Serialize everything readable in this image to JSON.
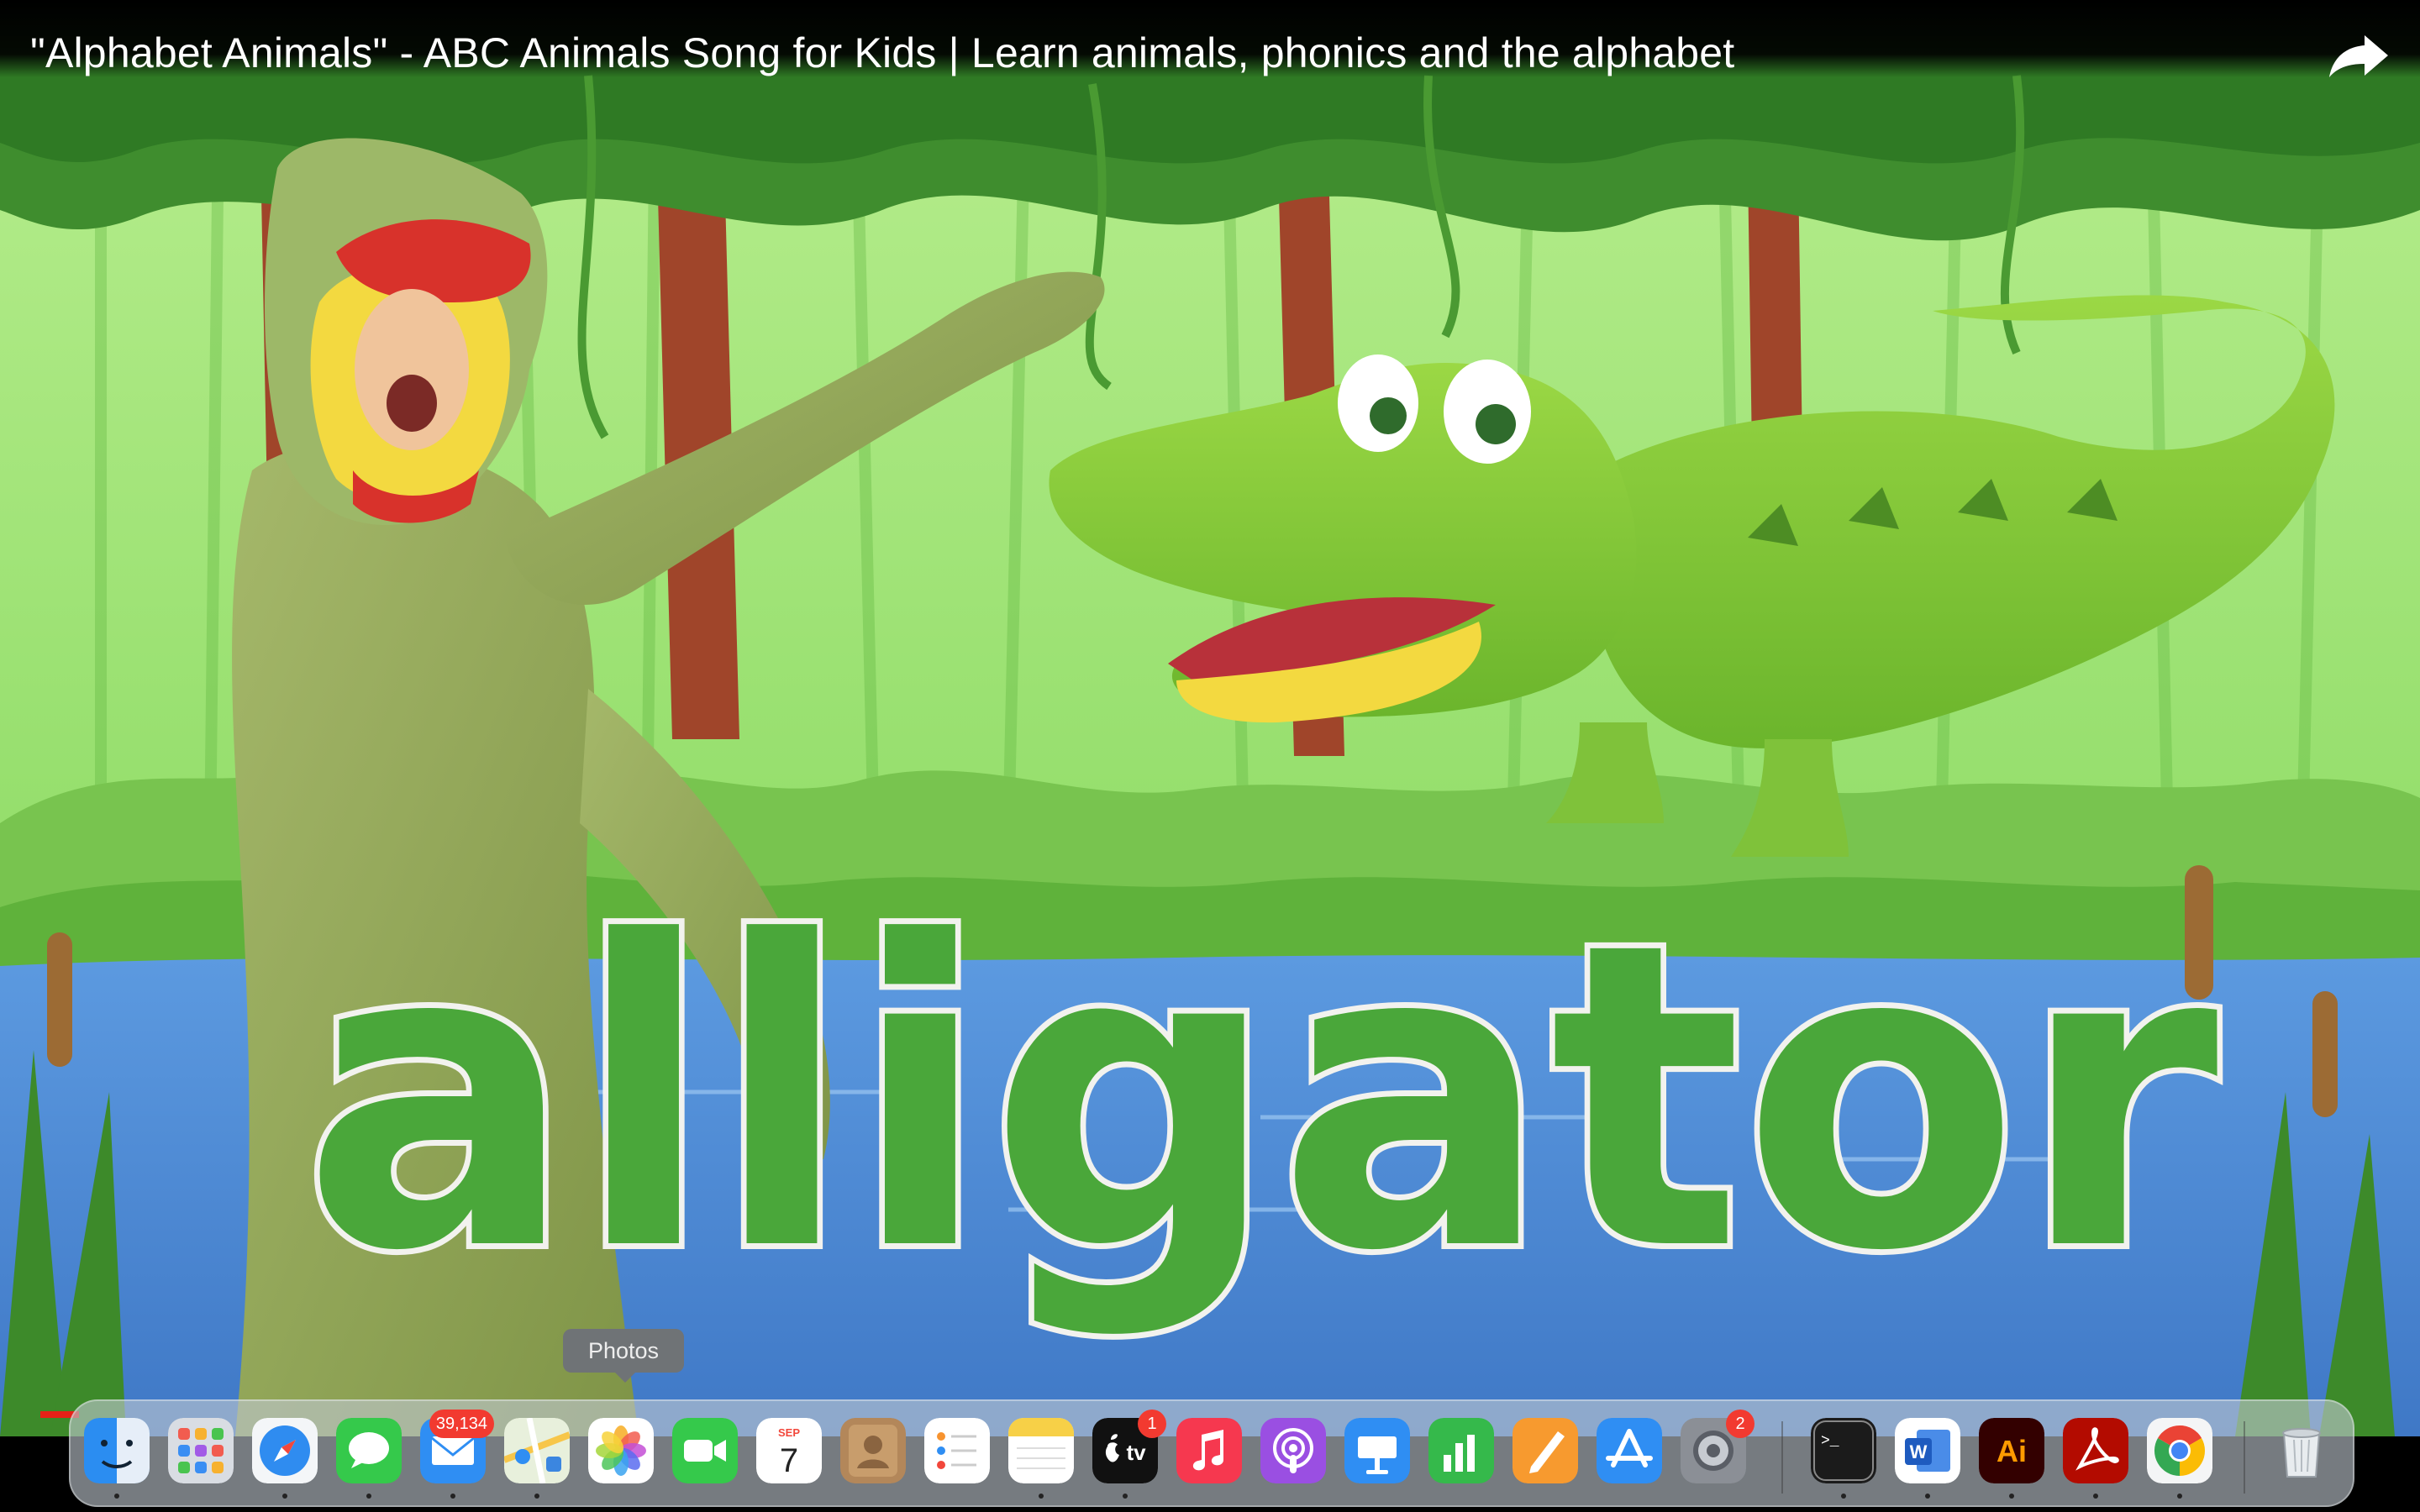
{
  "video": {
    "title": "\"Alphabet Animals\" - ABC Animals Song for Kids | Learn animals, phonics and the alphabet",
    "caption_word": "alligator"
  },
  "dock": {
    "tooltip": "Photos",
    "items": [
      {
        "name": "Finder",
        "icon": "finder-icon",
        "running": true
      },
      {
        "name": "Launchpad",
        "icon": "launchpad-icon",
        "running": false
      },
      {
        "name": "Safari",
        "icon": "safari-icon",
        "running": true
      },
      {
        "name": "Messages",
        "icon": "messages-icon",
        "running": true
      },
      {
        "name": "Mail",
        "icon": "mail-icon",
        "badge": "39,134",
        "running": true
      },
      {
        "name": "Maps",
        "icon": "maps-icon",
        "running": true
      },
      {
        "name": "Photos",
        "icon": "photos-icon",
        "running": false
      },
      {
        "name": "FaceTime",
        "icon": "facetime-icon",
        "running": false
      },
      {
        "name": "Calendar",
        "icon": "calendar-icon",
        "month": "SEP",
        "day": "7",
        "running": false
      },
      {
        "name": "Contacts",
        "icon": "contacts-icon",
        "running": false
      },
      {
        "name": "Reminders",
        "icon": "reminders-icon",
        "running": false
      },
      {
        "name": "Notes",
        "icon": "notes-icon",
        "running": true
      },
      {
        "name": "TV",
        "icon": "tv-icon",
        "label": "tv",
        "badge": "1",
        "running": true
      },
      {
        "name": "Music",
        "icon": "music-icon",
        "running": false
      },
      {
        "name": "Podcasts",
        "icon": "podcasts-icon",
        "running": false
      },
      {
        "name": "Keynote",
        "icon": "keynote-icon",
        "running": false
      },
      {
        "name": "Numbers",
        "icon": "numbers-icon",
        "running": false
      },
      {
        "name": "Pages",
        "icon": "pages-icon",
        "running": false
      },
      {
        "name": "App Store",
        "icon": "app-store-icon",
        "running": false
      },
      {
        "name": "System Preferences",
        "icon": "system-preferences-icon",
        "badge": "2",
        "running": false
      },
      {
        "name": "Terminal",
        "icon": "terminal-icon",
        "label": ">_",
        "running": true
      },
      {
        "name": "Microsoft Word",
        "icon": "word-icon",
        "label": "W",
        "running": true
      },
      {
        "name": "Adobe Illustrator",
        "icon": "illustrator-icon",
        "label": "Ai",
        "running": true
      },
      {
        "name": "Adobe Acrobat",
        "icon": "acrobat-icon",
        "running": true
      },
      {
        "name": "Google Chrome",
        "icon": "chrome-icon",
        "running": true
      },
      {
        "name": "Trash",
        "icon": "trash-icon",
        "running": false
      }
    ]
  },
  "colors": {
    "progress": "#e62117",
    "jungle_light": "#9fe07a",
    "jungle_dark": "#3f8d2e",
    "water": "#4f8fd6",
    "word_fill": "#4aa73a"
  }
}
